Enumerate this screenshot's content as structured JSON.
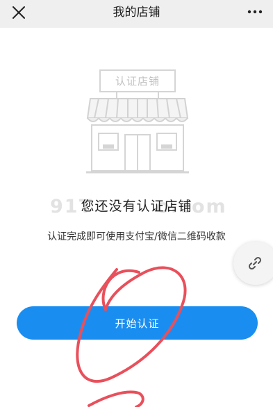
{
  "navbar": {
    "title": "我的店铺",
    "close_icon": "close-icon",
    "more_icon": "more-dots-icon"
  },
  "illustration": {
    "sign_text": "认证店铺",
    "icon": "storefront-illustration"
  },
  "message": {
    "title": "您还没有认证店铺",
    "subtitle": "认证完成即可使用支付宝/微信二维码收款"
  },
  "watermark": "91T        o.com",
  "float_button": {
    "icon": "link-icon"
  },
  "start_button": {
    "label": "开始认证"
  },
  "colors": {
    "accent": "#1a8ef0",
    "navbar_bg": "#efefef",
    "annotation": "#e8505b"
  }
}
